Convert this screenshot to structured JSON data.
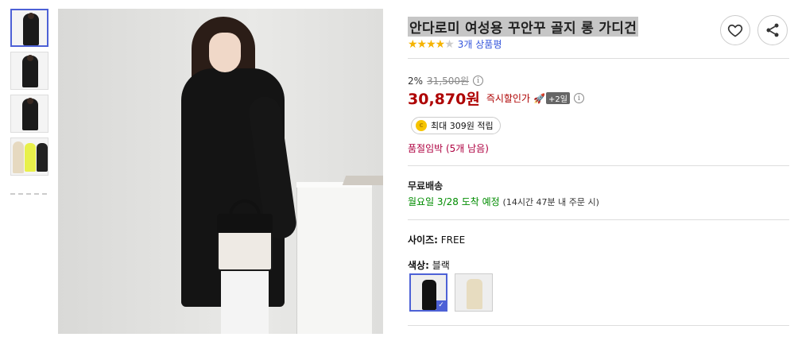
{
  "product": {
    "title": "안다로미 여성용 꾸안꾸 골지 롱 가디건",
    "stars": "★★★★",
    "star_off": "★",
    "review_count": "3개 상품평",
    "rating_value": 4
  },
  "actions": {
    "heart_icon": "heart-icon",
    "share_icon": "share-icon"
  },
  "price": {
    "discount": "2%",
    "original": "31,500원",
    "sale": "30,870원",
    "instant_label": "즉시할인가",
    "rocket_badge": "+2일",
    "rocket_glyph": "🚀"
  },
  "points": {
    "coin_glyph": "c",
    "text": "최대 309원 적립"
  },
  "stock": {
    "text": "품절임박 (5개 남음)"
  },
  "shipping": {
    "title": "무료배송",
    "eta_day": "월요일 3/28",
    "eta_label": "도착 예정",
    "eta_note": "(14시간 47분 내 주문 시)"
  },
  "options": {
    "size_label": "사이즈:",
    "size_value": "FREE",
    "color_label": "색상:",
    "color_value": "블랙",
    "check_glyph": "✓"
  },
  "info_glyph": "i",
  "colors": {
    "accent": "#4d61d6",
    "price": "#ae0000",
    "stock": "#ae0040",
    "eta": "#008c00",
    "star": "#f5b301"
  }
}
